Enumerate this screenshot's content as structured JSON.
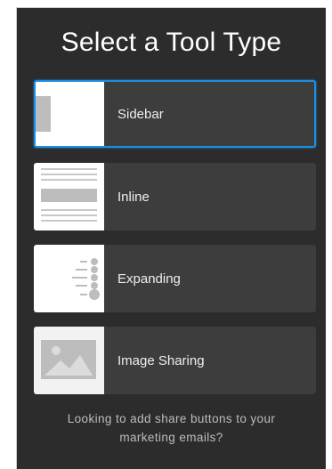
{
  "title": "Select a Tool Type",
  "tools": [
    {
      "label": "Sidebar",
      "icon": "sidebar-layout-icon",
      "selected": true
    },
    {
      "label": "Inline",
      "icon": "inline-layout-icon",
      "selected": false
    },
    {
      "label": "Expanding",
      "icon": "expanding-layout-icon",
      "selected": false
    },
    {
      "label": "Image Sharing",
      "icon": "image-sharing-icon",
      "selected": false
    }
  ],
  "footer": {
    "line1": "Looking to add share buttons to your",
    "line2": "marketing emails?"
  },
  "colors": {
    "panel_bg": "#2c2c2c",
    "tile_bg": "#3d3d3d",
    "selected_border": "#1a8fe3",
    "thumb_bg": "#ffffff",
    "icon_gray": "#bdbdbd"
  }
}
